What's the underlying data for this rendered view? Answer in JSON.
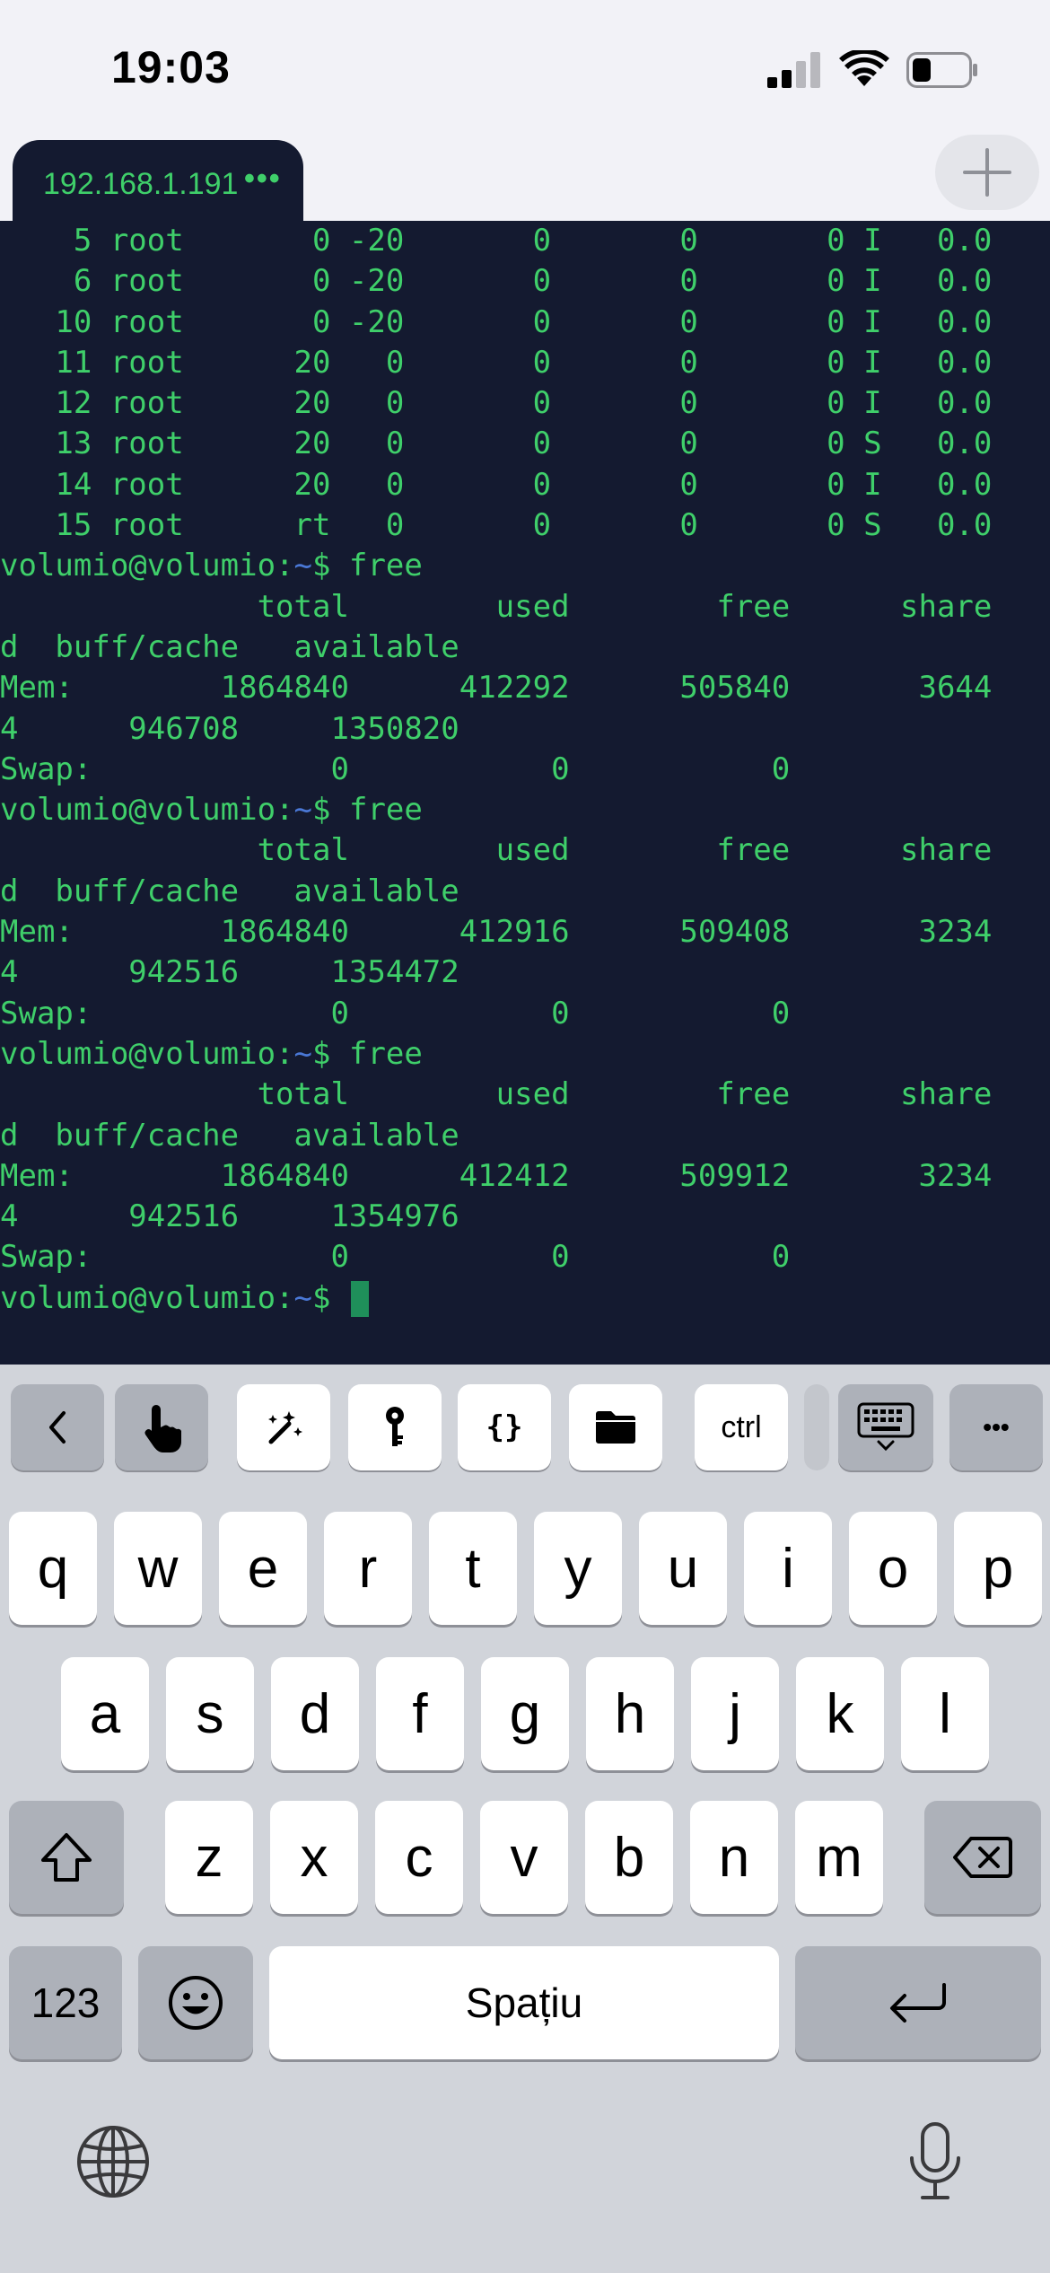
{
  "status_bar": {
    "time": "19:03"
  },
  "tab": {
    "label": "192.168.1.191",
    "menu": "•••"
  },
  "terminal": {
    "prompt_user": "volumio@volumio",
    "prompt_sep": ":",
    "prompt_path": "~",
    "prompt_symbol": "$",
    "lines": [
      {
        "type": "text",
        "text": "    5 root       0 -20       0       0       0 I   0.0"
      },
      {
        "type": "text",
        "text": "    6 root       0 -20       0       0       0 I   0.0"
      },
      {
        "type": "text",
        "text": "   10 root       0 -20       0       0       0 I   0.0"
      },
      {
        "type": "text",
        "text": "   11 root      20   0       0       0       0 I   0.0"
      },
      {
        "type": "text",
        "text": "   12 root      20   0       0       0       0 I   0.0"
      },
      {
        "type": "text",
        "text": "   13 root      20   0       0       0       0 S   0.0"
      },
      {
        "type": "text",
        "text": "   14 root      20   0       0       0       0 I   0.0"
      },
      {
        "type": "text",
        "text": "   15 root      rt   0       0       0       0 S   0.0"
      },
      {
        "type": "prompt",
        "cmd": " free"
      },
      {
        "type": "text",
        "text": "              total        used        free      share"
      },
      {
        "type": "text",
        "text": "d  buff/cache   available"
      },
      {
        "type": "text",
        "text": "Mem:        1864840      412292      505840       3644"
      },
      {
        "type": "text",
        "text": "4      946708     1350820"
      },
      {
        "type": "text",
        "text": "Swap:             0           0           0"
      },
      {
        "type": "prompt",
        "cmd": " free"
      },
      {
        "type": "text",
        "text": "              total        used        free      share"
      },
      {
        "type": "text",
        "text": "d  buff/cache   available"
      },
      {
        "type": "text",
        "text": "Mem:        1864840      412916      509408       3234"
      },
      {
        "type": "text",
        "text": "4      942516     1354472"
      },
      {
        "type": "text",
        "text": "Swap:             0           0           0"
      },
      {
        "type": "prompt",
        "cmd": " free"
      },
      {
        "type": "text",
        "text": "              total        used        free      share"
      },
      {
        "type": "text",
        "text": "d  buff/cache   available"
      },
      {
        "type": "text",
        "text": "Mem:        1864840      412412      509912       3234"
      },
      {
        "type": "text",
        "text": "4      942516     1354976"
      },
      {
        "type": "text",
        "text": "Swap:             0           0           0"
      },
      {
        "type": "prompt",
        "cmd": " ",
        "cursor": true
      }
    ]
  },
  "toolbar": {
    "ctrl_label": "ctrl",
    "braces_label": "{}",
    "more_label": "•••"
  },
  "keyboard": {
    "row1": [
      "q",
      "w",
      "e",
      "r",
      "t",
      "y",
      "u",
      "i",
      "o",
      "p"
    ],
    "row2": [
      "a",
      "s",
      "d",
      "f",
      "g",
      "h",
      "j",
      "k",
      "l"
    ],
    "row3": [
      "z",
      "x",
      "c",
      "v",
      "b",
      "n",
      "m"
    ],
    "numbers_label": "123",
    "space_label": "Spațiu"
  },
  "colors": {
    "terminal_bg": "#141a30",
    "terminal_text": "#3fcf6a",
    "prompt_path": "#4a78d6",
    "keyboard_bg": "#d1d4da"
  }
}
